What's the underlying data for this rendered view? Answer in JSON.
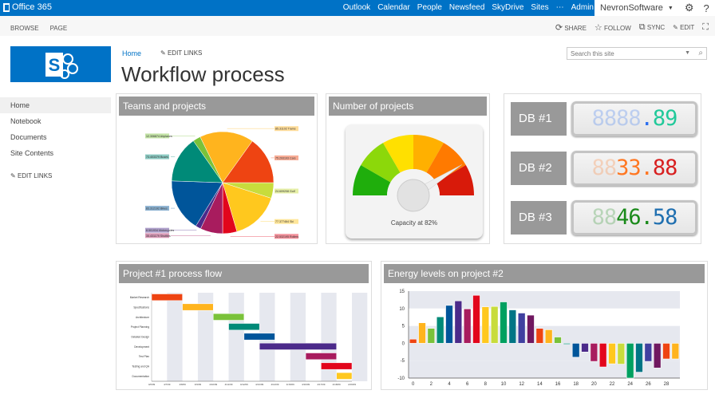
{
  "topbar": {
    "brand": "Office 365",
    "nav": [
      "Outlook",
      "Calendar",
      "People",
      "Newsfeed",
      "SkyDrive",
      "Sites",
      "⋯",
      "Admin"
    ],
    "user": "NevronSoftware",
    "color": "#0072c6"
  },
  "ribbon": {
    "tabs": [
      "BROWSE",
      "PAGE"
    ],
    "actions": [
      {
        "icon": "sync-icon",
        "label": "SHARE"
      },
      {
        "icon": "star-icon",
        "label": "FOLLOW"
      },
      {
        "icon": "sync-folder-icon",
        "label": "SYNC"
      },
      {
        "icon": "pencil-icon",
        "label": "EDIT"
      }
    ]
  },
  "leftnav": {
    "items": [
      "Home",
      "Notebook",
      "Documents",
      "Site Contents"
    ],
    "edit_links": "EDIT LINKS"
  },
  "header": {
    "breadcrumb": "Home",
    "edit_links": "EDIT LINKS",
    "title": "Workflow process",
    "search_placeholder": "Search this site"
  },
  "parts": {
    "pie": "Teams and projects",
    "gauge": "Number of projects",
    "gantt": "Project #1 process flow",
    "bars": "Energy levels on project #2"
  },
  "gauge": {
    "value": 82,
    "label": "Capacity at 82%"
  },
  "displays": [
    {
      "label": "DB #1",
      "ghost": "8888",
      "value": ".89",
      "colors": [
        "#2a6ef0",
        "#21c99a"
      ]
    },
    {
      "label": "DB #2",
      "ghost": "88",
      "value": "33.88",
      "colors": [
        "#ff7722",
        "#d82020"
      ]
    },
    {
      "label": "DB #3",
      "ghost": "88",
      "value": "46.58",
      "colors": [
        "#1a8a1a",
        "#1f6fb0"
      ]
    }
  ],
  "chart_data": [
    {
      "type": "pie",
      "slices": [
        {
          "label": "24.609208 Golf",
          "value": 24.6,
          "color": "#c8dc3c"
        },
        {
          "label": "77.377464 Ski",
          "value": 77.4,
          "color": "#ffc81e"
        },
        {
          "label": "22.532195 Rollers",
          "value": 22.5,
          "color": "#e2061c"
        },
        {
          "label": "35.431179 Shuttles",
          "value": 35.4,
          "color": "#a81c5e"
        },
        {
          "label": "8.501934 Motorcycles",
          "value": 8.5,
          "color": "#4b2a8a"
        },
        {
          "label": "83.312192 Bikes",
          "value": 83.3,
          "color": "#00559a"
        },
        {
          "label": "73.403379 Buses",
          "value": 73.4,
          "color": "#008a78"
        },
        {
          "label": "12.306874 Airplanes",
          "value": 12.3,
          "color": "#7ac23a"
        },
        {
          "label": "85.31102 Trains",
          "value": 85.3,
          "color": "#ffb41e"
        },
        {
          "label": "75.293193 Cars",
          "value": 75.3,
          "color": "#ee4412"
        }
      ]
    },
    {
      "type": "gantt",
      "tasks": [
        {
          "name": "Market Research",
          "start": 0,
          "end": 2,
          "color": "#ee4412"
        },
        {
          "name": "Specifications",
          "start": 2,
          "end": 4,
          "color": "#ffb41e"
        },
        {
          "name": "Architecture",
          "start": 4,
          "end": 6,
          "color": "#7ac23a"
        },
        {
          "name": "Project Planning",
          "start": 5,
          "end": 7,
          "color": "#008a78"
        },
        {
          "name": "Detailed Design",
          "start": 6,
          "end": 8,
          "color": "#00559a"
        },
        {
          "name": "Development",
          "start": 7,
          "end": 12,
          "color": "#4b2a8a"
        },
        {
          "name": "Test Plan",
          "start": 10,
          "end": 12,
          "color": "#a81c5e"
        },
        {
          "name": "Testing and QA",
          "start": 11,
          "end": 13,
          "color": "#e2061c"
        },
        {
          "name": "Documentation",
          "start": 12,
          "end": 13,
          "color": "#ffc81e"
        }
      ],
      "x_ticks": [
        "4/6/09",
        "4/7/09",
        "4/8/09",
        "4/9/09",
        "4/10/09",
        "4/11/09",
        "4/12/09",
        "4/13/09",
        "4/14/09",
        "4/15/09",
        "4/16/09",
        "4/17/09",
        "4/18/09",
        "4/19/09"
      ]
    },
    {
      "type": "bar",
      "x": [
        0,
        1,
        2,
        3,
        4,
        5,
        6,
        7,
        8,
        9,
        10,
        11,
        12,
        13,
        14,
        15,
        16,
        17,
        18,
        19,
        20,
        21,
        22,
        23,
        24,
        25,
        26,
        27,
        28,
        29
      ],
      "values": [
        1.2,
        5.9,
        4.3,
        7.6,
        10.9,
        12.2,
        9.9,
        13.8,
        10.5,
        10.6,
        11.9,
        9.6,
        8.7,
        8.1,
        4.3,
        3.9,
        1.8,
        -0.3,
        -4,
        -2.5,
        -5.2,
        -6.8,
        -5.9,
        -6,
        -10,
        -8.3,
        -5.2,
        -7.1,
        -4.5,
        -4.5
      ],
      "ylim": [
        -10,
        15
      ],
      "y_ticks": [
        15,
        10,
        5,
        0,
        -5,
        -10
      ],
      "x_ticks": [
        0,
        2,
        4,
        6,
        8,
        10,
        12,
        14,
        16,
        18,
        20,
        22,
        24,
        26,
        28
      ],
      "palette": [
        "#ee4412",
        "#ffb41e",
        "#7ac23a",
        "#008a78",
        "#00559a",
        "#4b2a8a",
        "#a81c5e",
        "#e2061c",
        "#ffc81e",
        "#c8dc3c",
        "#00a060",
        "#007585",
        "#4040a0",
        "#701860"
      ]
    }
  ]
}
